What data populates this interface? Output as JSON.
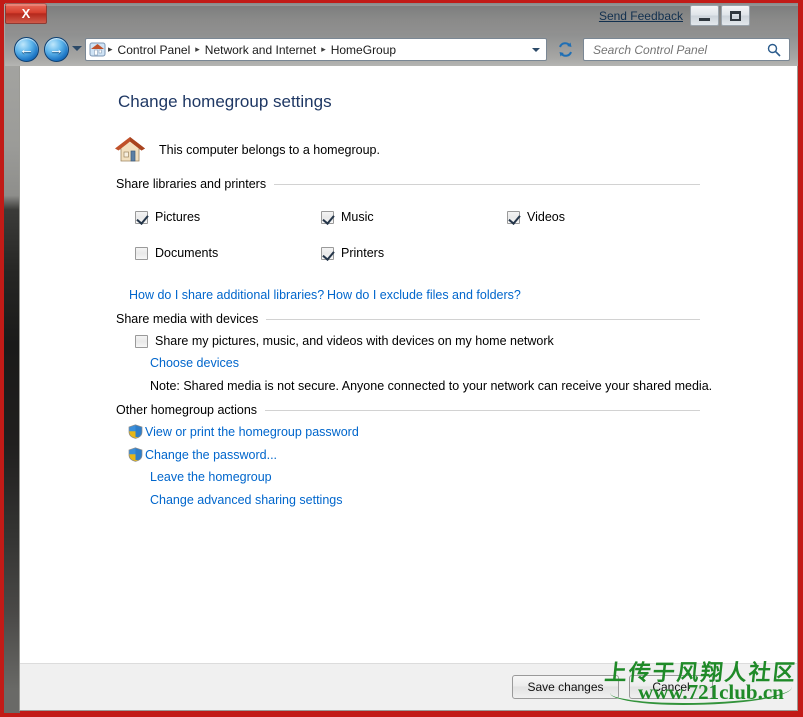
{
  "window": {
    "send_feedback": "Send Feedback",
    "minimize_label": "Minimize",
    "maximize_label": "Maximize",
    "close_label": "X"
  },
  "navbar": {
    "back_glyph": "←",
    "forward_glyph": "→",
    "breadcrumbs": [
      "Control Panel",
      "Network and Internet",
      "HomeGroup"
    ],
    "separator": "▸",
    "refresh_icon": "refresh-icon",
    "search": {
      "placeholder": "Search Control Panel",
      "value": ""
    }
  },
  "page": {
    "title": "Change homegroup settings",
    "status_text": "This computer belongs to a homegroup."
  },
  "share_libraries": {
    "header": "Share libraries and printers",
    "items": [
      {
        "label": "Pictures",
        "checked": true
      },
      {
        "label": "Music",
        "checked": true
      },
      {
        "label": "Videos",
        "checked": true
      },
      {
        "label": "Documents",
        "checked": false
      },
      {
        "label": "Printers",
        "checked": true
      }
    ],
    "help_links": [
      "How do I share additional libraries?",
      "How do I exclude files and folders?"
    ]
  },
  "share_media": {
    "header": "Share media with devices",
    "checkbox_label": "Share my pictures, music, and videos with devices on my home network",
    "checkbox_checked": false,
    "choose_devices_link": "Choose devices",
    "note": "Note: Shared media is not secure. Anyone connected to your network can receive your shared media."
  },
  "other_actions": {
    "header": "Other homegroup actions",
    "items": [
      {
        "label": "View or print the homegroup password",
        "shield": true
      },
      {
        "label": "Change the password...",
        "shield": true
      },
      {
        "label": "Leave the homegroup",
        "shield": false
      },
      {
        "label": "Change advanced sharing settings",
        "shield": false
      }
    ]
  },
  "footer": {
    "save_label": "Save changes",
    "cancel_label": "Cancel"
  },
  "watermark": {
    "chinese": "上传于风翔人社区",
    "url": "www.721club.cn",
    "color": "#1f8a28"
  },
  "colors": {
    "frame_red": "#c21b17",
    "title_blue": "#1f3864",
    "link_blue": "#0066cc",
    "close_red": "#d8402f"
  }
}
